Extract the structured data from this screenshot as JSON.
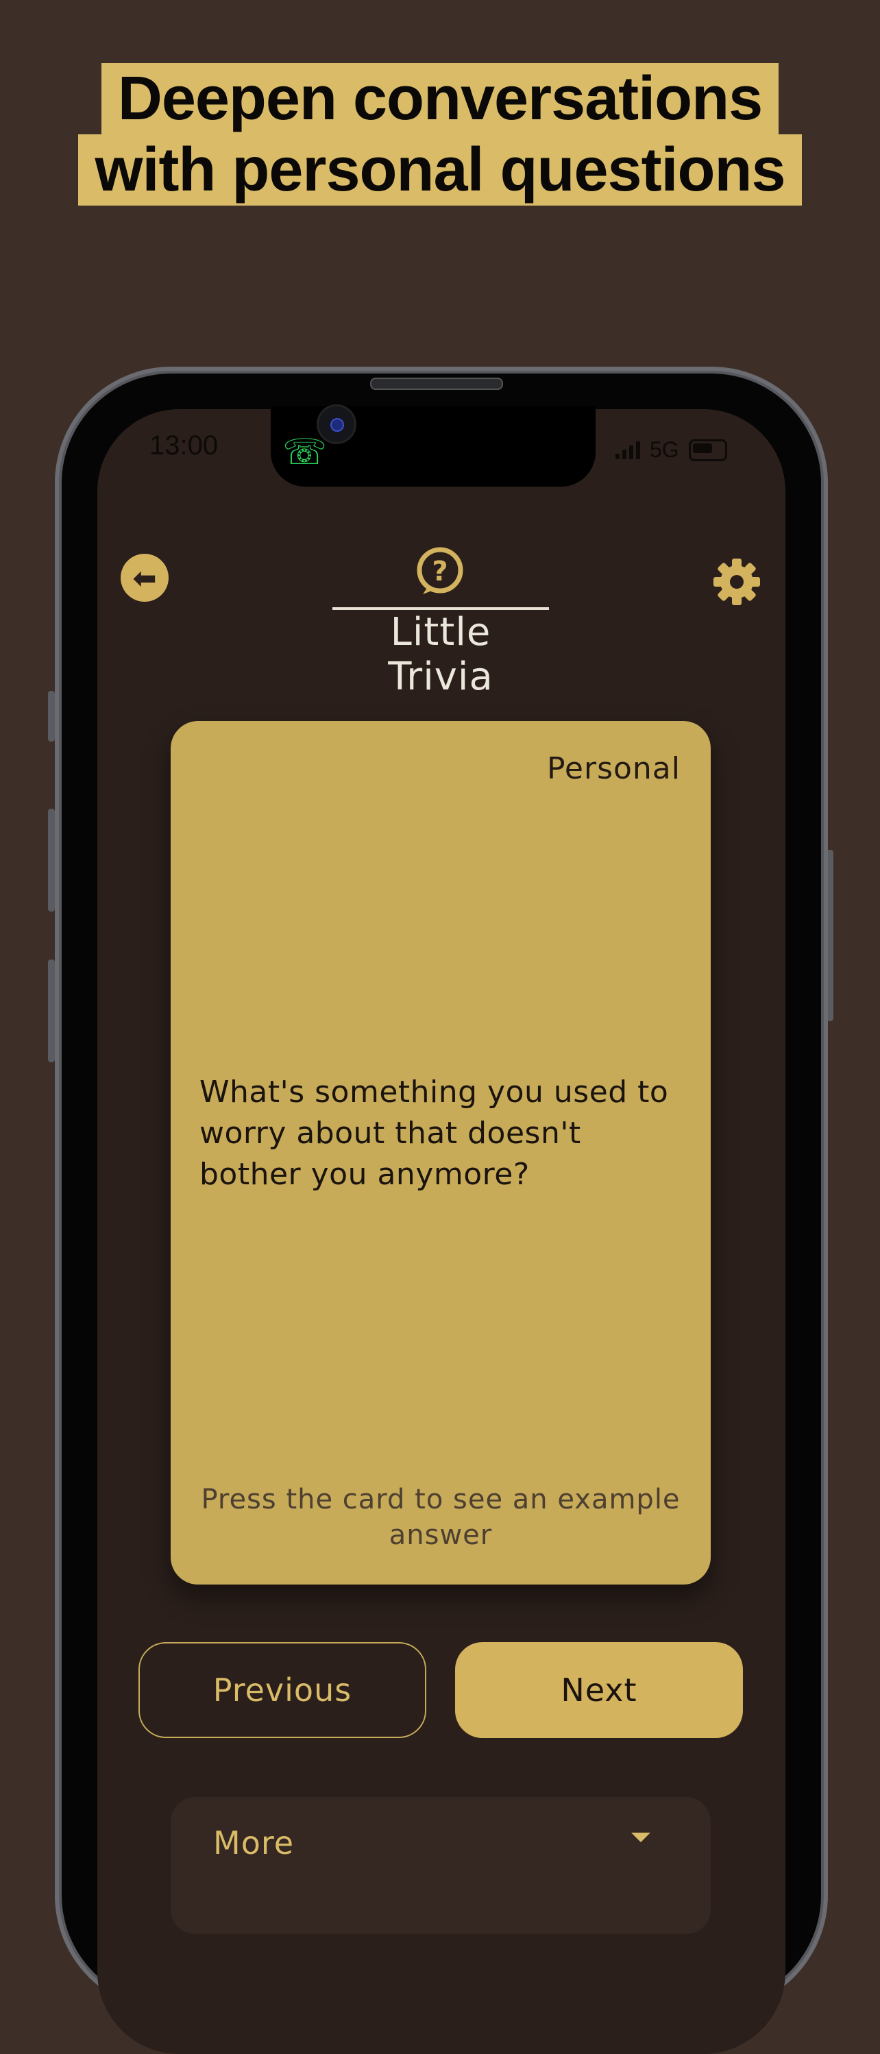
{
  "headline": {
    "line1": "Deepen conversations",
    "line2": "with personal questions"
  },
  "status_bar": {
    "time": "13:00",
    "network": "5G"
  },
  "app": {
    "title": "Little Trivia",
    "logo_icon": "question-bubble-icon",
    "back_icon": "arrow-left-icon",
    "settings_icon": "gear-icon"
  },
  "card": {
    "category": "Personal",
    "question": "What's something you used to worry about that doesn't bother you anymore?",
    "hint": "Press the card to see an example answer"
  },
  "buttons": {
    "previous": "Previous",
    "next": "Next"
  },
  "more": {
    "label": "More",
    "icon": "caret-down-icon"
  },
  "colors": {
    "background": "#3d2e28",
    "screen": "#2a1f1b",
    "gold": "#c7ab59",
    "headline_highlight": "#d9bb68"
  }
}
